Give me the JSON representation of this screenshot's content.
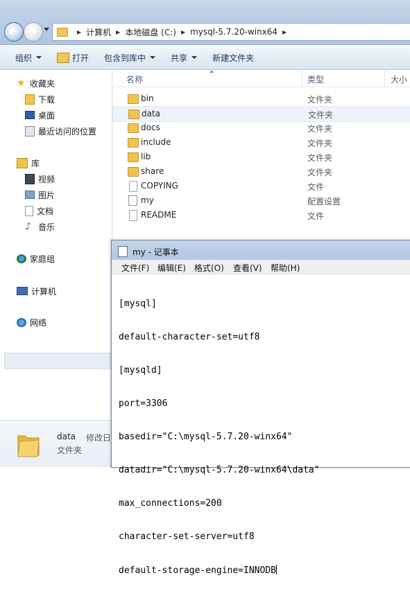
{
  "address": {
    "crumbs": [
      "计算机",
      "本地磁盘 (C:)",
      "mysql-5.7.20-winx64"
    ]
  },
  "toolbar": {
    "organize": "组织",
    "open": "打开",
    "include_in_library": "包含到库中",
    "share": "共享",
    "new_folder": "新建文件夹"
  },
  "nav": {
    "favorites": "收藏夹",
    "downloads": "下载",
    "desktop": "桌面",
    "recent": "最近访问的位置",
    "libraries": "库",
    "videos": "视频",
    "pictures": "图片",
    "documents": "文档",
    "music": "音乐",
    "homegroup": "家庭组",
    "computer": "计算机",
    "network": "网络"
  },
  "columns": {
    "name": "名称",
    "type": "类型",
    "size": "大小"
  },
  "files": [
    {
      "name": "bin",
      "type": "文件夹",
      "icon": "folder-icon"
    },
    {
      "name": "data",
      "type": "文件夹",
      "icon": "folder-icon"
    },
    {
      "name": "docs",
      "type": "文件夹",
      "icon": "folder-icon"
    },
    {
      "name": "include",
      "type": "文件夹",
      "icon": "folder-icon"
    },
    {
      "name": "lib",
      "type": "文件夹",
      "icon": "folder-icon"
    },
    {
      "name": "share",
      "type": "文件夹",
      "icon": "folder-icon"
    },
    {
      "name": "COPYING",
      "type": "文件",
      "icon": "file-icon"
    },
    {
      "name": "my",
      "type": "配置设置",
      "icon": "config-file-icon"
    },
    {
      "name": "README",
      "type": "文件",
      "icon": "file-icon"
    }
  ],
  "details": {
    "name": "data",
    "type": "文件夹",
    "modified_label": "修改日"
  },
  "notepad": {
    "title": "my - 记事本",
    "menu": [
      "文件(F)",
      "编辑(E)",
      "格式(O)",
      "查看(V)",
      "帮助(H)"
    ],
    "lines": [
      "[mysql]",
      "default-character-set=utf8",
      "[mysqld]",
      "port=3306",
      "basedir=\"C:\\mysql-5.7.20-winx64\"",
      "datadir=\"C:\\mysql-5.7.20-winx64\\data\"",
      "max_connections=200",
      "character-set-server=utf8",
      "default-storage-engine=INNODB"
    ]
  },
  "colors": {
    "selection": "#eef3fa",
    "accent": "#1e395b"
  }
}
